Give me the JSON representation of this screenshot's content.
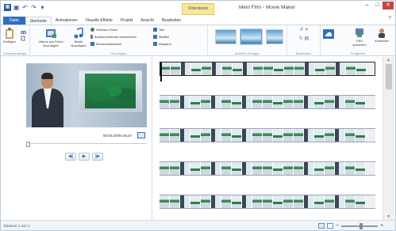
{
  "window": {
    "title": "Mein Film - Movie Maker",
    "context_tab": "Videotools"
  },
  "ribbon_tabs": [
    "Datei",
    "Startseite",
    "Animationen",
    "Visuelle Effekte",
    "Projekt",
    "Ansicht",
    "Bearbeiten"
  ],
  "ribbon": {
    "paste": "Einfügen",
    "add_media": "Videos und Fotos hinzufügen",
    "add_music": "Musik hinzufügen",
    "webcam": "Webcam-Video",
    "narration": "Audiokommentar aufzeichnen",
    "snapshot": "Momentaufnahme",
    "title": "Titel",
    "caption": "Bildtitel",
    "credits": "Abspann",
    "share_save": "Film speichern",
    "sign_in": "Anmelden",
    "groups": {
      "clipboard": "Zwischenablage",
      "add": "Hinzufügen",
      "themes": "AutoFilm-Designs",
      "edit": "Bearbeiten",
      "share": "Freigeben"
    }
  },
  "preview": {
    "timecode": "00:00,00/00:46,67"
  },
  "storyboard": {
    "rows": 5,
    "frames_per_row": 20
  },
  "status": {
    "text": "Element 1 von 1"
  },
  "zoom": {
    "level": 0.55
  },
  "colors": {
    "file_tab": "#2f6ebd",
    "context_tab": "#f6e79a",
    "close_button": "#c7463e"
  }
}
